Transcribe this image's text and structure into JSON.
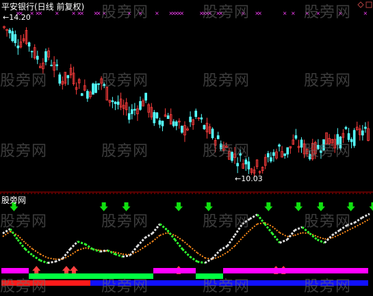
{
  "window": {
    "title": "平安银行(日线 前复权)",
    "indicator_name": "股旁网",
    "watermark": "股旁网"
  },
  "price_panel": {
    "high_label": "14.20",
    "low_label": "10.03",
    "ylim": [
      9.6,
      14.6
    ]
  },
  "chart_data": [
    {
      "type": "candlestick",
      "title": "平安银行(日线 前复权)",
      "annotations": [
        {
          "text": "14.20",
          "value": 14.2
        },
        {
          "text": "10.03",
          "value": 10.03
        }
      ],
      "trend_close": [
        14.1,
        13.95,
        13.7,
        13.8,
        13.4,
        13.1,
        13.3,
        12.9,
        12.6,
        12.8,
        12.5,
        12.3,
        12.4,
        12.6,
        12.2,
        12.0,
        11.85,
        11.7,
        11.9,
        12.1,
        11.6,
        11.5,
        11.7,
        11.4,
        11.2,
        11.4,
        11.6,
        11.3,
        11.1,
        10.9,
        10.7,
        10.5,
        10.4,
        10.3,
        10.2,
        10.3,
        10.5,
        10.7,
        10.6,
        10.9,
        10.8,
        10.6,
        10.7,
        10.9,
        11.0,
        10.9,
        11.1,
        11.0,
        11.2,
        11.15
      ],
      "colors": {
        "up": "#ff3d3d",
        "down": "#54ffff",
        "marker": "#ff40ff"
      }
    },
    {
      "type": "line",
      "title": "股旁网",
      "series_values": {
        "fast": [
          0.55,
          0.62,
          0.45,
          0.3,
          0.2,
          0.12,
          0.08,
          0.1,
          0.15,
          0.3,
          0.42,
          0.38,
          0.3,
          0.26,
          0.28,
          0.22,
          0.18,
          0.2,
          0.35,
          0.48,
          0.55,
          0.7,
          0.6,
          0.45,
          0.3,
          0.18,
          0.1,
          0.08,
          0.15,
          0.28,
          0.35,
          0.52,
          0.7,
          0.78,
          0.85,
          0.7,
          0.55,
          0.4,
          0.45,
          0.6,
          0.65,
          0.55,
          0.45,
          0.4,
          0.52,
          0.6,
          0.68,
          0.72,
          0.8,
          0.86
        ],
        "slow": [
          0.5,
          0.58,
          0.52,
          0.4,
          0.3,
          0.22,
          0.16,
          0.14,
          0.14,
          0.2,
          0.28,
          0.32,
          0.3,
          0.28,
          0.27,
          0.25,
          0.22,
          0.21,
          0.26,
          0.34,
          0.42,
          0.52,
          0.56,
          0.52,
          0.44,
          0.34,
          0.24,
          0.16,
          0.14,
          0.18,
          0.25,
          0.35,
          0.48,
          0.6,
          0.7,
          0.72,
          0.66,
          0.56,
          0.5,
          0.52,
          0.56,
          0.55,
          0.5,
          0.46,
          0.48,
          0.53,
          0.59,
          0.65,
          0.71,
          0.78
        ]
      },
      "buy_signals": [
        5,
        9,
        10,
        24,
        37,
        38
      ],
      "sell_signals": [
        2,
        14,
        17,
        24,
        28,
        36,
        40,
        43,
        47,
        50
      ]
    }
  ],
  "colors": {
    "bar_magenta": "#ff00ff",
    "bar_green": "#00ff40",
    "bar_red": "#ff1a1a",
    "bar_blue": "#1010ff",
    "title_text": "#ffffff",
    "price_label": "#ffffff"
  }
}
